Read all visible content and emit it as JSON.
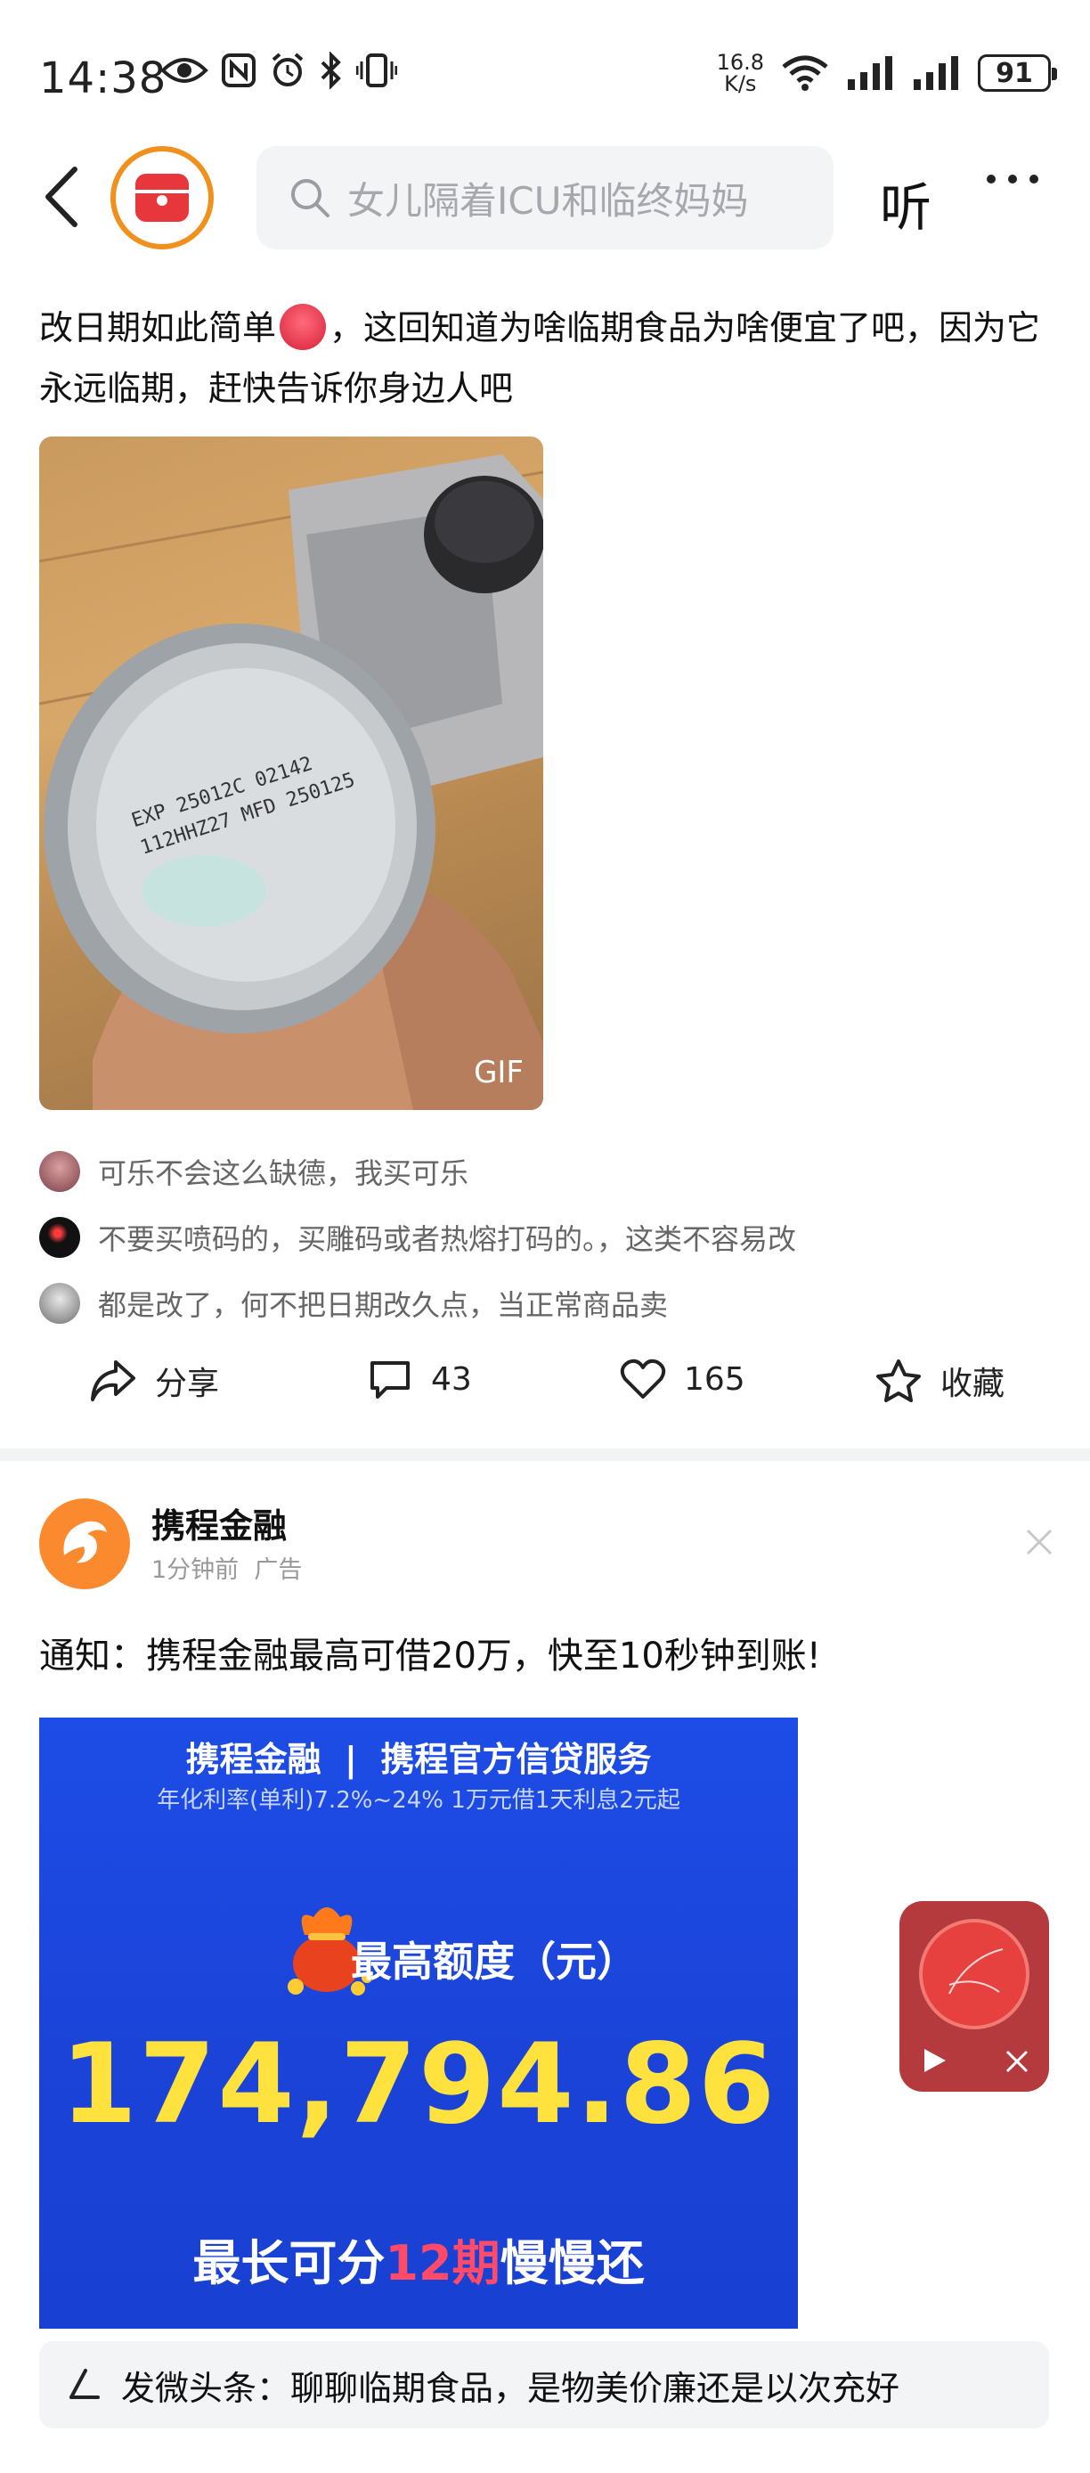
{
  "status_bar": {
    "time": "14:38",
    "net_speed_value": "16.8",
    "net_speed_unit": "K/s",
    "battery": "91"
  },
  "header": {
    "search_placeholder": "女儿隔着ICU和临终妈妈",
    "listen_label": "听"
  },
  "post": {
    "text_part1": "改日期如此简单",
    "text_part2": "，这回知道为啥临期食品为啥便宜了吧，因为它永远临期，赶快告诉你身边人吧",
    "gif_label": "GIF",
    "comments": [
      {
        "text": "可乐不会这么缺德，我买可乐"
      },
      {
        "text": "不要买喷码的，买雕码或者热熔打码的。，这类不容易改"
      },
      {
        "text": "都是改了，何不把日期改久点，当正常商品卖"
      }
    ],
    "actions": {
      "share": "分享",
      "comments": "43",
      "likes": "165",
      "favorite": "收藏"
    }
  },
  "ad": {
    "name": "携程金融",
    "time": "1分钟前",
    "tag": "广告",
    "text": "通知：携程金融最高可借20万，快至10秒钟到账!",
    "banner": {
      "brand": "携程金融",
      "service": "携程官方信贷服务",
      "rate_text": "年化利率(单利)7.2%~24% 1万元借1天利息2元起",
      "quota_label": "最高额度（元）",
      "amount": "174,794.86",
      "bottom_pre": "最长可分",
      "bottom_highlight": "12期",
      "bottom_post": "慢慢还"
    }
  },
  "bottom_bar": {
    "text": "发微头条：聊聊临期食品，是物美价廉还是以次充好"
  }
}
